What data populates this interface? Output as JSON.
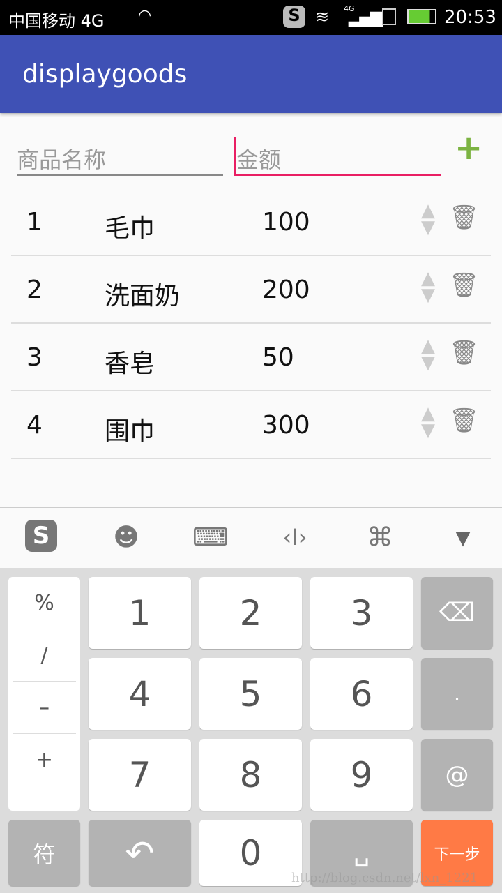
{
  "status": {
    "carrier": "中国移动 4G",
    "time": "20:53",
    "network": "4G"
  },
  "app": {
    "title": "displaygoods"
  },
  "form": {
    "name_placeholder": "商品名称",
    "amount_placeholder": "金额",
    "add_icon": "plus-icon",
    "accent": "#e91e63",
    "add_color": "#7cb342"
  },
  "items": [
    {
      "no": "1",
      "name": "毛巾",
      "price": "100"
    },
    {
      "no": "2",
      "name": "洗面奶",
      "price": "200"
    },
    {
      "no": "3",
      "name": "香皂",
      "price": "50"
    },
    {
      "no": "4",
      "name": "围巾",
      "price": "300"
    }
  ],
  "keyboard": {
    "side": [
      "%",
      "/",
      "–",
      "+"
    ],
    "digits": [
      "1",
      "2",
      "3",
      "4",
      "5",
      "6",
      "7",
      "8",
      "9",
      "0"
    ],
    "dot": ".",
    "at": "@",
    "symbol": "符",
    "next": "下一步",
    "next_color": "#ff7a45"
  },
  "watermark": "http://blog.csdn.net/lxn_1221"
}
